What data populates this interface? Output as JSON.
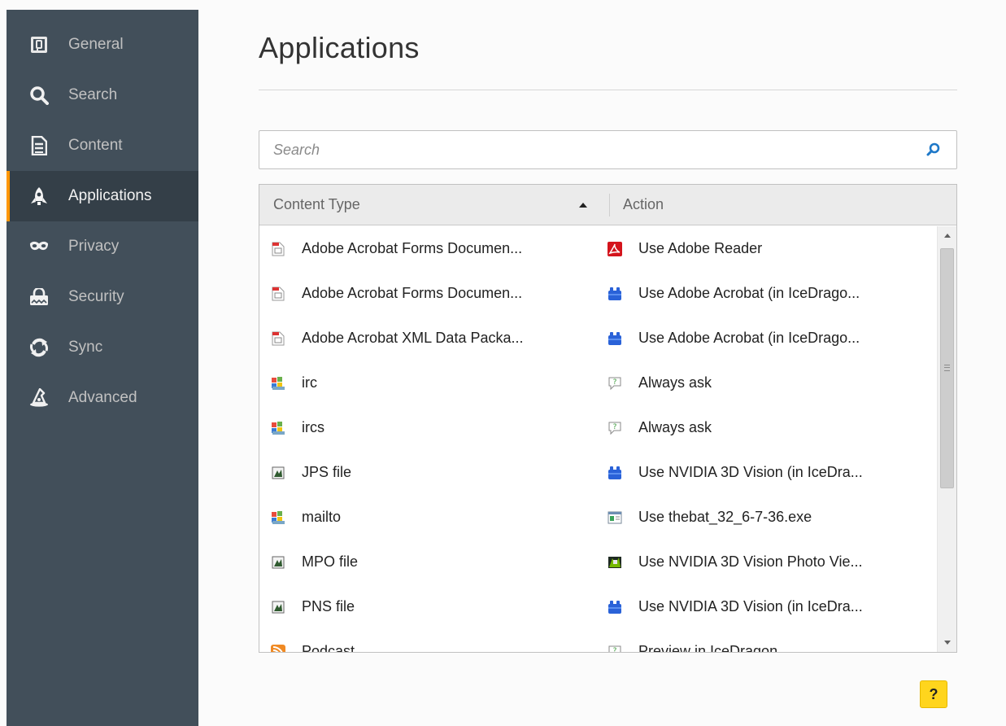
{
  "sidebar": {
    "items": [
      {
        "label": "General",
        "icon": "general-icon"
      },
      {
        "label": "Search",
        "icon": "search-icon"
      },
      {
        "label": "Content",
        "icon": "content-icon"
      },
      {
        "label": "Applications",
        "icon": "rocket-icon",
        "active": true
      },
      {
        "label": "Privacy",
        "icon": "mask-icon"
      },
      {
        "label": "Security",
        "icon": "lock-icon"
      },
      {
        "label": "Sync",
        "icon": "sync-icon"
      },
      {
        "label": "Advanced",
        "icon": "wizard-hat-icon"
      }
    ],
    "accent": "#ff9500",
    "bg": "#424f5a"
  },
  "main": {
    "title": "Applications",
    "search": {
      "placeholder": "Search"
    },
    "table": {
      "columns": {
        "content_type": "Content Type",
        "action": "Action"
      },
      "sort": "ascending",
      "rows": [
        {
          "content_type": "Adobe Acrobat Forms Documen...",
          "ct_icon": "pdf-form-icon",
          "action": "Use Adobe Reader",
          "ac_icon": "adobe-reader-icon"
        },
        {
          "content_type": "Adobe Acrobat Forms Documen...",
          "ct_icon": "pdf-form-icon",
          "action": "Use Adobe Acrobat (in IceDrago...",
          "ac_icon": "plugin-icon"
        },
        {
          "content_type": "Adobe Acrobat XML Data Packa...",
          "ct_icon": "pdf-form-icon",
          "action": "Use Adobe Acrobat (in IceDrago...",
          "ac_icon": "plugin-icon"
        },
        {
          "content_type": "irc",
          "ct_icon": "protocol-icon",
          "action": "Always ask",
          "ac_icon": "ask-icon"
        },
        {
          "content_type": "ircs",
          "ct_icon": "protocol-icon",
          "action": "Always ask",
          "ac_icon": "ask-icon"
        },
        {
          "content_type": "JPS file",
          "ct_icon": "image-file-icon",
          "action": "Use NVIDIA 3D Vision (in IceDra...",
          "ac_icon": "plugin-icon"
        },
        {
          "content_type": "mailto",
          "ct_icon": "protocol-icon",
          "action": "Use thebat_32_6-7-36.exe",
          "ac_icon": "app-window-icon"
        },
        {
          "content_type": "MPO file",
          "ct_icon": "image-file-icon",
          "action": "Use NVIDIA 3D Vision Photo Vie...",
          "ac_icon": "nvidia-viewer-icon"
        },
        {
          "content_type": "PNS file",
          "ct_icon": "image-file-icon",
          "action": "Use NVIDIA 3D Vision (in IceDra...",
          "ac_icon": "plugin-icon"
        },
        {
          "content_type": "Podcast",
          "ct_icon": "feed-icon",
          "action": "Preview in IceDragon",
          "ac_icon": "ask-icon"
        }
      ]
    },
    "help_label": "?"
  }
}
